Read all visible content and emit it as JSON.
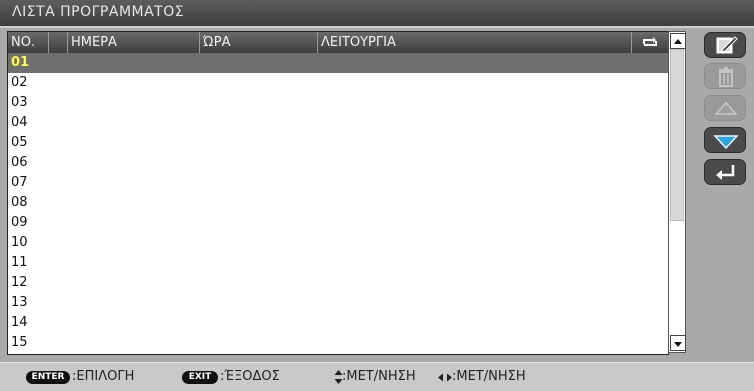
{
  "window": {
    "title": "ΛΙΣΤΑ ΠΡΟΓΡΑΜΜΑΤΟΣ"
  },
  "table": {
    "headers": {
      "no": "ΝΟ.",
      "day": "ΗΜΕΡΑ",
      "time": "ΏΡΑ",
      "function": "ΛΕΙΤΟΥΡΓΙΑ",
      "repeat_icon": "repeat-icon"
    },
    "rows": [
      "01",
      "02",
      "03",
      "04",
      "05",
      "06",
      "07",
      "08",
      "09",
      "10",
      "11",
      "12",
      "13",
      "14",
      "15"
    ],
    "selected_row": "01"
  },
  "side_buttons": {
    "edit": "edit-icon",
    "delete": "trash-icon",
    "move_up": "triangle-up-icon",
    "move_down": "triangle-down-icon",
    "back": "return-icon"
  },
  "footer": {
    "enter_key": "ENTER",
    "enter_label": ":ΕΠΙΛΟΓΗ",
    "exit_key": "EXIT",
    "exit_label": ":ΈΞΟΔΟΣ",
    "vertical_nav_label": ":ΜΕΤ/ΝΗΣΗ",
    "horizontal_nav_label": ":ΜΕΤ/ΝΗΣΗ"
  },
  "colors": {
    "selected_text": "#ffff33",
    "accent_blue": "#2aa6e6"
  }
}
